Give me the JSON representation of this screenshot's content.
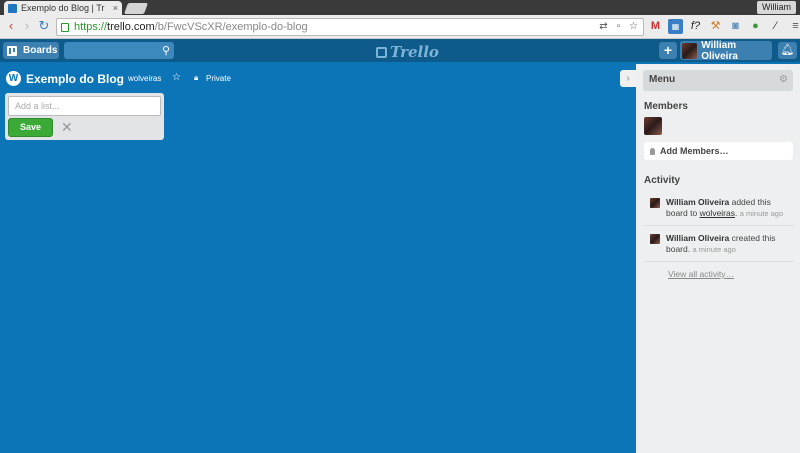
{
  "browser": {
    "tab_title": "Exemplo do Blog | Tr",
    "tab_close": "×",
    "user_name": "William",
    "url_https": "https://",
    "url_host": "trello.com",
    "url_path": "/b/FwcVScXR/exemplo-do-blog"
  },
  "header": {
    "boards_label": "Boards",
    "logo_text": "Trello",
    "add_symbol": "+",
    "user_name": "William Oliveira"
  },
  "board": {
    "title": "Exemplo do Blog",
    "org": "wolveiras",
    "visibility": "Private",
    "add_list_placeholder": "Add a list...",
    "save_label": "Save",
    "cancel_symbol": "✕"
  },
  "sidebar": {
    "menu_title": "Menu",
    "members_title": "Members",
    "add_members_label": "Add Members…",
    "activity_title": "Activity",
    "activities": [
      {
        "name": "William Oliveira",
        "text_before": " added this board to ",
        "link": "wolveiras",
        "text_after": ".",
        "time": "a minute ago"
      },
      {
        "name": "William Oliveira",
        "text_before": " created this board.",
        "link": "",
        "text_after": "",
        "time": "a minute ago"
      }
    ],
    "view_all_label": "View all activity…"
  },
  "colors": {
    "board_background": "#0b75b8",
    "header_background": "#0e5a8a",
    "save_button": "#3caa37",
    "sidebar_background": "#edeff0"
  }
}
